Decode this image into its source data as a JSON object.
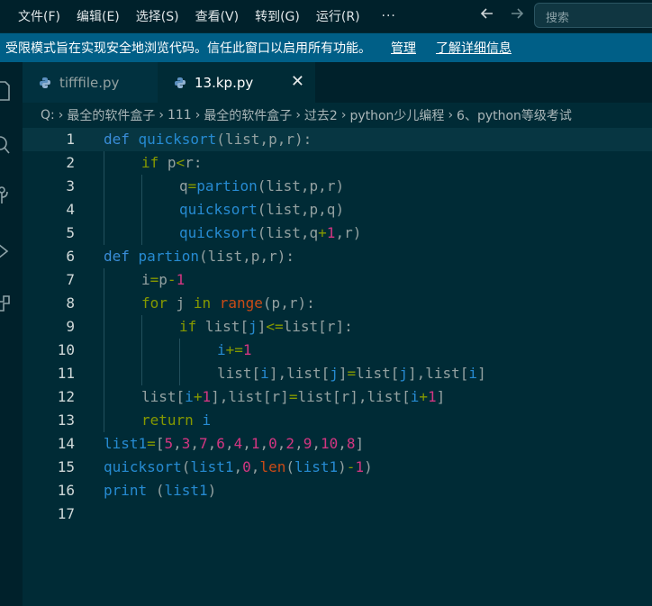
{
  "menu": {
    "items": [
      "文件(F)",
      "编辑(E)",
      "选择(S)",
      "查看(V)",
      "转到(G)",
      "运行(R)"
    ],
    "more": "···",
    "back_icon": "arrow-left-icon",
    "forward_icon": "arrow-right-icon"
  },
  "search": {
    "placeholder": "搜索"
  },
  "restricted": {
    "message": "受限模式旨在实现安全地浏览代码。信任此窗口以启用所有功能。",
    "manage": "管理",
    "learn_more": "了解详细信息"
  },
  "tabs": [
    {
      "label": "tifffile.py",
      "active": false
    },
    {
      "label": "13.kp.py",
      "active": true,
      "close": "✕"
    }
  ],
  "breadcrumb": [
    "Q:",
    "最全的软件盒子",
    "111",
    "最全的软件盒子",
    "过去2",
    "python少儿编程",
    "6、python等级考试"
  ],
  "colors": {
    "background": "#002b36",
    "keyword": "#859900",
    "function": "#268bd2",
    "builtin": "#cb4b16",
    "number": "#d33682",
    "banner": "#005f87"
  },
  "code": {
    "current_line": 1,
    "lines": [
      {
        "n": "1",
        "indent": 0,
        "tokens": [
          [
            "def",
            "df"
          ],
          [
            " ",
            "id"
          ],
          [
            "quicksort",
            "fn"
          ],
          [
            "(",
            "pn"
          ],
          [
            "list",
            "id"
          ],
          [
            ",",
            "pn"
          ],
          [
            "p",
            "id"
          ],
          [
            ",",
            "pn"
          ],
          [
            "r",
            "id"
          ],
          [
            "):",
            "pn"
          ]
        ]
      },
      {
        "n": "2",
        "indent": 1,
        "tokens": [
          [
            "if",
            "kw"
          ],
          [
            " ",
            "id"
          ],
          [
            "p",
            "id"
          ],
          [
            "<",
            "op"
          ],
          [
            "r",
            "id"
          ],
          [
            ":",
            "pn"
          ]
        ]
      },
      {
        "n": "3",
        "indent": 2,
        "tokens": [
          [
            "q",
            "id"
          ],
          [
            "=",
            "op"
          ],
          [
            "partion",
            "fn"
          ],
          [
            "(",
            "pn"
          ],
          [
            "list",
            "id"
          ],
          [
            ",",
            "pn"
          ],
          [
            "p",
            "id"
          ],
          [
            ",",
            "pn"
          ],
          [
            "r",
            "id"
          ],
          [
            ")",
            "pn"
          ]
        ]
      },
      {
        "n": "4",
        "indent": 2,
        "tokens": [
          [
            "quicksort",
            "fn"
          ],
          [
            "(",
            "pn"
          ],
          [
            "list",
            "id"
          ],
          [
            ",",
            "pn"
          ],
          [
            "p",
            "id"
          ],
          [
            ",",
            "pn"
          ],
          [
            "q",
            "id"
          ],
          [
            ")",
            "pn"
          ]
        ]
      },
      {
        "n": "5",
        "indent": 2,
        "tokens": [
          [
            "quicksort",
            "fn"
          ],
          [
            "(",
            "pn"
          ],
          [
            "list",
            "id"
          ],
          [
            ",",
            "pn"
          ],
          [
            "q",
            "id"
          ],
          [
            "+",
            "op"
          ],
          [
            "1",
            "nu"
          ],
          [
            ",",
            "pn"
          ],
          [
            "r",
            "id"
          ],
          [
            ")",
            "pn"
          ]
        ]
      },
      {
        "n": "6",
        "indent": 0,
        "tokens": [
          [
            "def",
            "df"
          ],
          [
            " ",
            "id"
          ],
          [
            "partion",
            "fn"
          ],
          [
            "(",
            "pn"
          ],
          [
            "list",
            "id"
          ],
          [
            ",",
            "pn"
          ],
          [
            "p",
            "id"
          ],
          [
            ",",
            "pn"
          ],
          [
            "r",
            "id"
          ],
          [
            "):",
            "pn"
          ]
        ]
      },
      {
        "n": "7",
        "indent": 1,
        "tokens": [
          [
            "i",
            "id"
          ],
          [
            "=",
            "op"
          ],
          [
            "p",
            "id"
          ],
          [
            "-",
            "op"
          ],
          [
            "1",
            "nu"
          ]
        ]
      },
      {
        "n": "8",
        "indent": 1,
        "tokens": [
          [
            "for",
            "kw"
          ],
          [
            " ",
            "id"
          ],
          [
            "j",
            "id"
          ],
          [
            " ",
            "id"
          ],
          [
            "in",
            "kw"
          ],
          [
            " ",
            "id"
          ],
          [
            "range",
            "bi"
          ],
          [
            "(",
            "pn"
          ],
          [
            "p",
            "id"
          ],
          [
            ",",
            "pn"
          ],
          [
            "r",
            "id"
          ],
          [
            "):",
            "pn"
          ]
        ]
      },
      {
        "n": "9",
        "indent": 2,
        "tokens": [
          [
            "if",
            "kw"
          ],
          [
            " ",
            "id"
          ],
          [
            "list",
            "id"
          ],
          [
            "[",
            "pn"
          ],
          [
            "j",
            "fn"
          ],
          [
            "]",
            "pn"
          ],
          [
            "<=",
            "op"
          ],
          [
            "list",
            "id"
          ],
          [
            "[",
            "pn"
          ],
          [
            "r",
            "id"
          ],
          [
            "]:",
            "pn"
          ]
        ]
      },
      {
        "n": "10",
        "indent": 3,
        "tokens": [
          [
            "i",
            "fn"
          ],
          [
            "+=",
            "op"
          ],
          [
            "1",
            "nu"
          ]
        ]
      },
      {
        "n": "11",
        "indent": 3,
        "tokens": [
          [
            "list",
            "id"
          ],
          [
            "[",
            "pn"
          ],
          [
            "i",
            "fn"
          ],
          [
            "],",
            "pn"
          ],
          [
            "list",
            "id"
          ],
          [
            "[",
            "pn"
          ],
          [
            "j",
            "fn"
          ],
          [
            "]",
            "pn"
          ],
          [
            "=",
            "op"
          ],
          [
            "list",
            "id"
          ],
          [
            "[",
            "pn"
          ],
          [
            "j",
            "fn"
          ],
          [
            "],",
            "pn"
          ],
          [
            "list",
            "id"
          ],
          [
            "[",
            "pn"
          ],
          [
            "i",
            "fn"
          ],
          [
            "]",
            "pn"
          ]
        ]
      },
      {
        "n": "12",
        "indent": 1,
        "tokens": [
          [
            "list",
            "id"
          ],
          [
            "[",
            "pn"
          ],
          [
            "i",
            "fn"
          ],
          [
            "+",
            "op"
          ],
          [
            "1",
            "nu"
          ],
          [
            "],",
            "pn"
          ],
          [
            "list",
            "id"
          ],
          [
            "[",
            "pn"
          ],
          [
            "r",
            "id"
          ],
          [
            "]",
            "pn"
          ],
          [
            "=",
            "op"
          ],
          [
            "list",
            "id"
          ],
          [
            "[",
            "pn"
          ],
          [
            "r",
            "id"
          ],
          [
            "],",
            "pn"
          ],
          [
            "list",
            "id"
          ],
          [
            "[",
            "pn"
          ],
          [
            "i",
            "fn"
          ],
          [
            "+",
            "op"
          ],
          [
            "1",
            "nu"
          ],
          [
            "]",
            "pn"
          ]
        ]
      },
      {
        "n": "13",
        "indent": 1,
        "tokens": [
          [
            "return",
            "kw"
          ],
          [
            " ",
            "id"
          ],
          [
            "i",
            "fn"
          ]
        ]
      },
      {
        "n": "14",
        "indent": 0,
        "tokens": [
          [
            "list1",
            "fn"
          ],
          [
            "=",
            "op"
          ],
          [
            "[",
            "pn"
          ],
          [
            "5",
            "nu"
          ],
          [
            ",",
            "pn"
          ],
          [
            "3",
            "nu"
          ],
          [
            ",",
            "pn"
          ],
          [
            "7",
            "nu"
          ],
          [
            ",",
            "pn"
          ],
          [
            "6",
            "nu"
          ],
          [
            ",",
            "pn"
          ],
          [
            "4",
            "nu"
          ],
          [
            ",",
            "pn"
          ],
          [
            "1",
            "nu"
          ],
          [
            ",",
            "pn"
          ],
          [
            "0",
            "nu"
          ],
          [
            ",",
            "pn"
          ],
          [
            "2",
            "nu"
          ],
          [
            ",",
            "pn"
          ],
          [
            "9",
            "nu"
          ],
          [
            ",",
            "pn"
          ],
          [
            "10",
            "nu"
          ],
          [
            ",",
            "pn"
          ],
          [
            "8",
            "nu"
          ],
          [
            "]",
            "pn"
          ]
        ]
      },
      {
        "n": "15",
        "indent": 0,
        "tokens": [
          [
            "quicksort",
            "fn"
          ],
          [
            "(",
            "pn"
          ],
          [
            "list1",
            "fn"
          ],
          [
            ",",
            "pn"
          ],
          [
            "0",
            "nu"
          ],
          [
            ",",
            "pn"
          ],
          [
            "len",
            "bi"
          ],
          [
            "(",
            "pn"
          ],
          [
            "list1",
            "fn"
          ],
          [
            ")",
            "pn"
          ],
          [
            "-",
            "op"
          ],
          [
            "1",
            "nu"
          ],
          [
            ")",
            "pn"
          ]
        ]
      },
      {
        "n": "16",
        "indent": 0,
        "tokens": [
          [
            "print",
            "fn"
          ],
          [
            " ",
            "id"
          ],
          [
            "(",
            "pn"
          ],
          [
            "list1",
            "fn"
          ],
          [
            ")",
            "pn"
          ]
        ]
      },
      {
        "n": "17",
        "indent": 0,
        "tokens": []
      }
    ]
  }
}
